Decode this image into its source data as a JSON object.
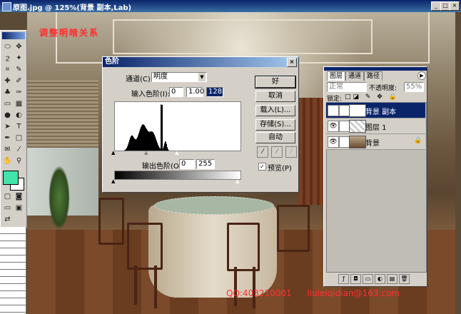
{
  "window": {
    "title": "原图.jpg @ 125%(背景 副本,Lab)",
    "min": "_",
    "max": "□",
    "close": "×"
  },
  "canvas": {
    "caption": "调整明暗关系",
    "contact_qq": "QQ:403210001",
    "contact_email": "liuleiqidian@163.com"
  },
  "levels_dialog": {
    "title": "色阶",
    "channel_label": "通道(C):",
    "channel_value": "明度",
    "input_levels_label": "输入色阶(I):",
    "input_values": [
      "0",
      "1.00",
      "128"
    ],
    "output_levels_label": "输出色阶(O):",
    "output_values": [
      "0",
      "255"
    ],
    "buttons": {
      "ok": "好",
      "cancel": "取消",
      "load": "载入(L)...",
      "save": "存储(S)...",
      "auto": "自动"
    },
    "preview_label": "预览(P)",
    "preview_checked": true
  },
  "layers_palette": {
    "tabs": [
      "图层",
      "通道",
      "路径"
    ],
    "blend_mode": "正常",
    "opacity_label": "不透明度:",
    "opacity_value": "55%",
    "lock_label": "锁定:",
    "layers": [
      {
        "name": "背景 副本",
        "active": true
      },
      {
        "name": "图层 1",
        "active": false
      },
      {
        "name": "背景",
        "active": false
      }
    ]
  },
  "swatches": {
    "foreground": "#43e3a9",
    "background": "#ffffff"
  },
  "histogram": [
    0,
    0,
    0,
    0,
    0,
    0,
    0,
    0,
    0,
    0,
    0,
    0,
    0,
    0,
    0,
    0,
    0,
    0,
    0,
    0,
    0,
    0,
    0,
    0,
    0,
    0,
    0,
    0,
    0,
    0,
    0,
    0,
    0,
    0,
    0,
    0,
    0,
    0,
    0,
    0,
    0,
    0,
    0,
    0,
    0,
    0,
    0,
    0,
    0,
    0,
    0,
    0,
    0,
    0,
    0,
    0,
    0,
    0,
    0,
    0,
    0,
    0,
    0,
    0,
    0,
    0,
    0,
    0,
    0,
    0,
    0,
    0,
    0,
    0,
    0,
    0,
    0,
    0,
    0,
    0,
    0,
    0,
    0,
    0,
    0,
    0,
    0,
    0,
    0,
    0,
    0,
    0,
    0,
    0,
    0,
    0,
    0,
    0,
    0,
    0,
    0,
    0,
    0,
    0,
    0,
    0,
    0,
    0,
    0,
    0,
    0,
    0,
    0,
    0,
    0,
    0,
    0,
    0,
    0,
    0,
    0,
    0,
    0,
    0,
    0,
    0,
    0,
    0,
    0,
    0,
    0,
    0,
    0,
    0,
    0,
    0,
    0,
    0,
    0,
    0,
    0,
    0,
    0,
    0,
    0,
    0,
    0,
    0,
    0,
    0,
    0,
    0,
    0,
    0,
    0,
    0,
    0,
    0,
    0,
    0,
    0,
    0,
    0,
    0,
    0,
    0,
    0,
    0,
    0,
    0,
    0,
    0,
    0,
    0,
    0,
    0,
    0,
    0,
    0,
    0,
    0,
    0,
    0,
    0,
    0,
    0,
    0,
    0,
    0,
    0,
    0,
    0,
    0,
    0,
    0,
    0,
    0,
    0,
    0,
    0,
    0,
    0,
    0,
    0,
    0,
    0,
    0,
    0,
    0,
    0,
    0,
    0,
    0,
    0,
    0,
    0,
    0,
    0,
    0,
    0,
    0,
    0,
    0,
    0,
    0,
    0,
    0,
    0,
    0,
    0,
    0,
    0,
    0,
    0,
    0,
    0,
    0,
    0,
    0,
    0,
    0,
    0,
    0,
    0,
    0,
    0,
    0,
    0
  ]
}
